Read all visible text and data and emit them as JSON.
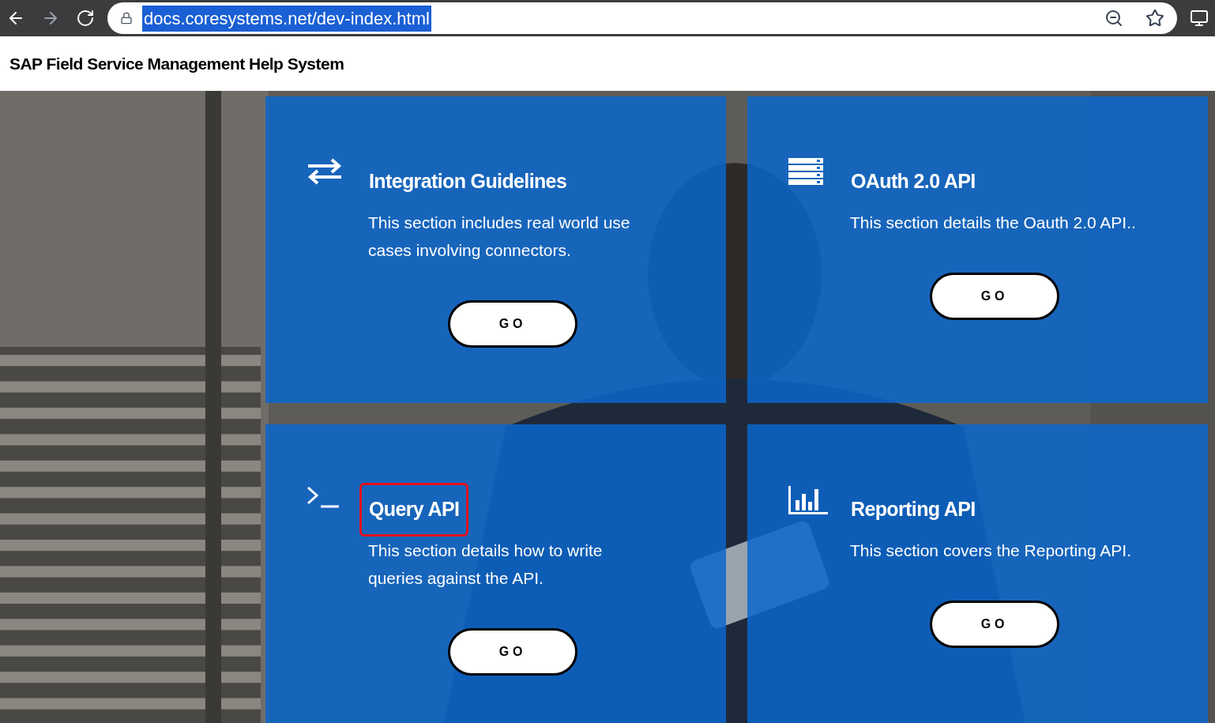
{
  "browser": {
    "url": "docs.coresystems.net/dev-index.html",
    "url_selected": true
  },
  "header": {
    "title": "SAP Field Service Management Help System"
  },
  "cards": [
    {
      "title": "Integration Guidelines",
      "description": "This section includes real world use cases involving connectors.",
      "button": "GO",
      "highlighted": false
    },
    {
      "title": "OAuth 2.0 API",
      "description": "This section details the Oauth 2.0 API..",
      "button": "GO",
      "highlighted": false
    },
    {
      "title": "Query API",
      "description": "This section details how to write queries against the API.",
      "button": "GO",
      "highlighted": true
    },
    {
      "title": "Reporting API",
      "description": "This section covers the Reporting API.",
      "button": "GO",
      "highlighted": false
    }
  ]
}
